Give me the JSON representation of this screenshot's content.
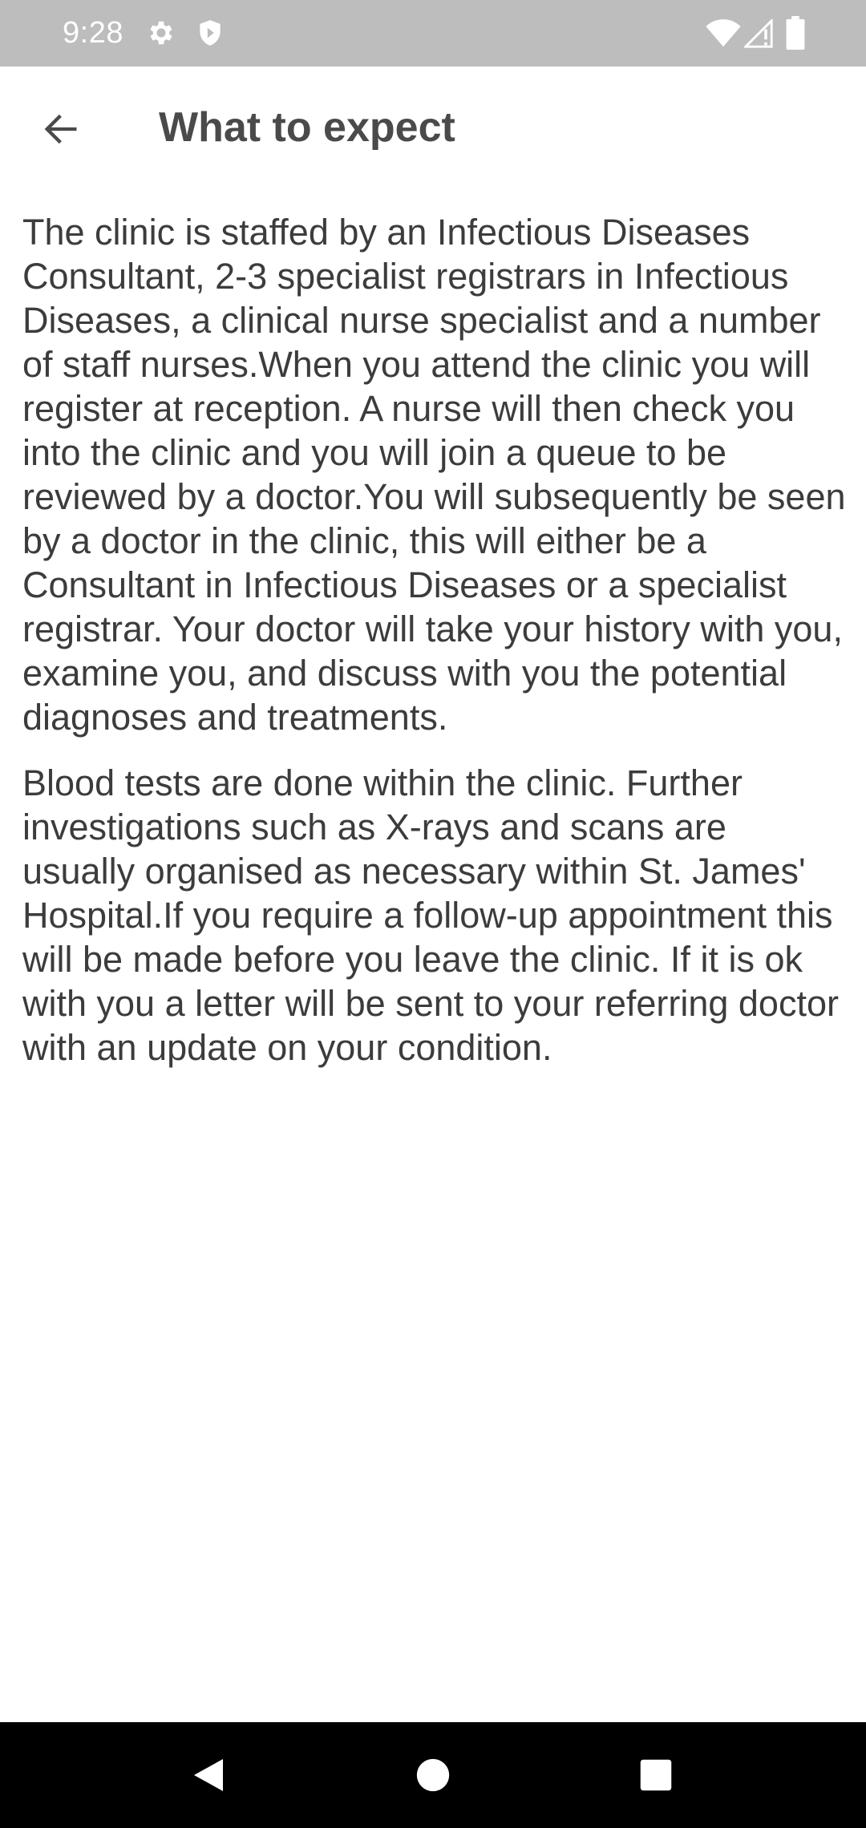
{
  "status_bar": {
    "time": "9:28",
    "icons": [
      "gear-icon",
      "shield-icon",
      "wifi-icon",
      "signal-icon",
      "battery-icon"
    ]
  },
  "app_bar": {
    "title": "What to expect",
    "back_icon": "arrow-left-icon"
  },
  "content": {
    "paragraphs": [
      "The clinic is staffed by an Infectious Diseases Consultant, 2-3 specialist registrars in Infectious Diseases, a clinical nurse specialist and a number of staff nurses.When you attend the clinic you will register at reception. A nurse will then check you into the clinic and you will join a queue to be reviewed by a doctor.You will subsequently be seen by a doctor in the clinic, this will either be a Consultant in Infectious Diseases or a specialist registrar. Your doctor will take your history with you, examine you, and discuss with you the potential diagnoses and treatments.",
      "Blood tests are done within the clinic. Further investigations such as X-rays and scans are usually organised as necessary within St. James' Hospital.If you require a follow-up appointment this will be made before you leave the clinic. If it is ok with you a letter will be sent to your referring doctor with an update on your condition."
    ]
  },
  "nav_bar": {
    "buttons": [
      "back-triangle-icon",
      "home-circle-icon",
      "recents-square-icon"
    ]
  },
  "colors": {
    "status_bar": "#bdbdbd",
    "title_text": "#4a4a4a",
    "body_text": "#3c3c3c",
    "nav_bar": "#000000"
  }
}
